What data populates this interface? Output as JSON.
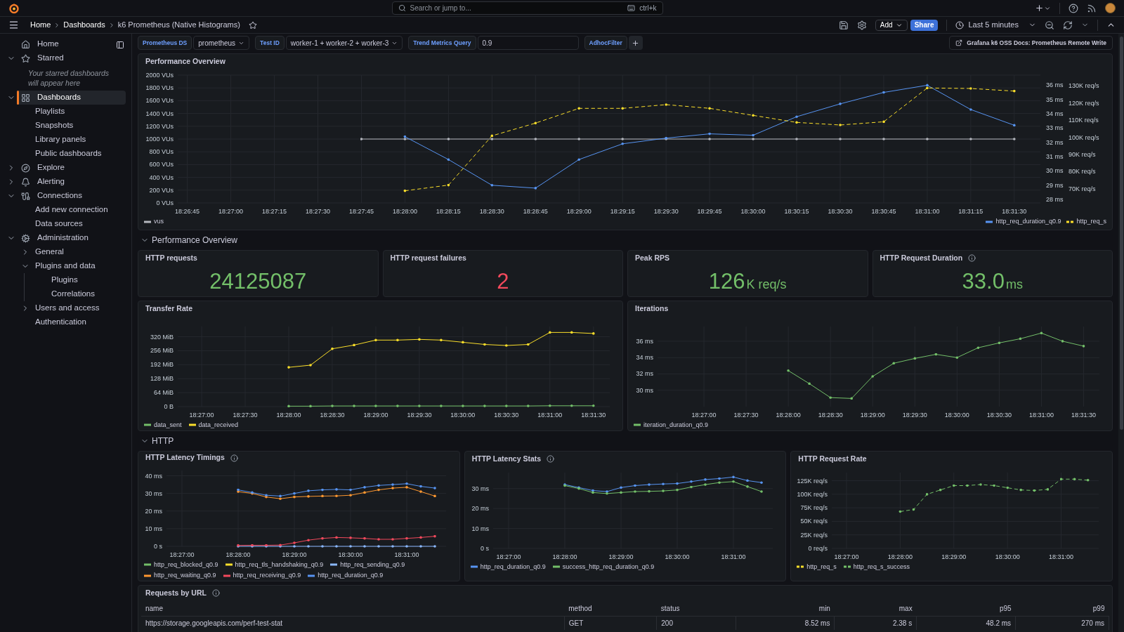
{
  "top_bar": {
    "search": {
      "placeholder": "Search or jump to...",
      "shortcut": "ctrl+k"
    }
  },
  "toolbar": {
    "breadcrumbs": [
      "Home",
      "Dashboards",
      "k6 Prometheus (Native Histograms)"
    ],
    "add_label": "Add",
    "share_label": "Share",
    "time_range": "Last 5 minutes"
  },
  "sidebar": {
    "items": [
      {
        "label": "Home",
        "selected": false
      },
      {
        "label": "Starred",
        "selected": false,
        "expanded": true,
        "note": "Your starred dashboards will appear here"
      },
      {
        "label": "Dashboards",
        "selected": true,
        "expanded": true,
        "children": [
          {
            "label": "Playlists",
            "selected": false
          },
          {
            "label": "Snapshots",
            "selected": false
          },
          {
            "label": "Library panels",
            "selected": false
          },
          {
            "label": "Public dashboards",
            "selected": false
          }
        ]
      },
      {
        "label": "Explore",
        "selected": false,
        "expanded": false
      },
      {
        "label": "Alerting",
        "selected": false,
        "expanded": false
      },
      {
        "label": "Connections",
        "selected": false,
        "expanded": true,
        "children": [
          {
            "label": "Add new connection",
            "selected": false
          },
          {
            "label": "Data sources",
            "selected": false
          }
        ]
      },
      {
        "label": "Administration",
        "selected": false,
        "expanded": true,
        "children": [
          {
            "label": "General",
            "selected": false,
            "expanded": false
          },
          {
            "label": "Plugins and data",
            "selected": false,
            "expanded": true,
            "children": [
              {
                "label": "Plugins",
                "selected": false
              },
              {
                "label": "Correlations",
                "selected": false
              }
            ]
          },
          {
            "label": "Users and access",
            "selected": false,
            "expanded": false
          },
          {
            "label": "Authentication",
            "selected": false
          }
        ]
      }
    ]
  },
  "variables": [
    {
      "kind": "select",
      "label": "Prometheus DS",
      "value": "prometheus"
    },
    {
      "kind": "select",
      "label": "Test ID",
      "value": "worker-1 + worker-2 + worker-3"
    },
    {
      "kind": "text",
      "label": "Trend Metrics Query",
      "value": "0.9"
    },
    {
      "kind": "adhoc",
      "label": "AdhocFilter"
    }
  ],
  "docs_link": "Grafana k6 OSS Docs: Prometheus Remote Write",
  "overview_panel": {
    "title": "Performance Overview",
    "chart_data": {
      "type": "line",
      "categories": [
        "18:26:45",
        "18:27:00",
        "18:27:15",
        "18:27:30",
        "18:27:45",
        "18:28:00",
        "18:28:15",
        "18:28:30",
        "18:28:45",
        "18:29:00",
        "18:29:15",
        "18:29:30",
        "18:29:45",
        "18:30:00",
        "18:30:15",
        "18:30:30",
        "18:30:45",
        "18:31:00",
        "18:31:15",
        "18:31:30"
      ],
      "grid": true,
      "ylim": [
        0,
        2000
      ],
      "y2lim": [
        27.76,
        36.71
      ],
      "y3lim": [
        61700,
        136300
      ],
      "yticks": [
        {
          "value": 0,
          "label": "0 VUs"
        },
        {
          "value": 200,
          "label": "200 VUs"
        },
        {
          "value": 400,
          "label": "400 VUs"
        },
        {
          "value": 600,
          "label": "600 VUs"
        },
        {
          "value": 800,
          "label": "800 VUs"
        },
        {
          "value": 1000,
          "label": "1000 VUs"
        },
        {
          "value": 1200,
          "label": "1200 VUs"
        },
        {
          "value": 1400,
          "label": "1400 VUs"
        },
        {
          "value": 1600,
          "label": "1600 VUs"
        },
        {
          "value": 1800,
          "label": "1800 VUs"
        },
        {
          "value": 2000,
          "label": "2000 VUs"
        }
      ],
      "y2ticks": [
        {
          "value": 28,
          "label": "28 ms"
        },
        {
          "value": 29,
          "label": "29 ms"
        },
        {
          "value": 30,
          "label": "30 ms"
        },
        {
          "value": 31,
          "label": "31 ms"
        },
        {
          "value": 32,
          "label": "32 ms"
        },
        {
          "value": 33,
          "label": "33 ms"
        },
        {
          "value": 34,
          "label": "34 ms"
        },
        {
          "value": 35,
          "label": "35 ms"
        },
        {
          "value": 36,
          "label": "36 ms"
        }
      ],
      "y3ticks": [
        {
          "value": 70000,
          "label": "70K req/s"
        },
        {
          "value": 80000,
          "label": "80K req/s"
        },
        {
          "value": 90000,
          "label": "90K req/s"
        },
        {
          "value": 100000,
          "label": "100K req/s"
        },
        {
          "value": 110000,
          "label": "110K req/s"
        },
        {
          "value": 120000,
          "label": "120K req/s"
        },
        {
          "value": 130000,
          "label": "130K req/s"
        }
      ],
      "series": [
        {
          "name": "vus",
          "color": "#b5b8bf",
          "axis": "y",
          "values": [
            null,
            null,
            null,
            null,
            1000,
            1000,
            1000,
            1000,
            1000,
            1000,
            1000,
            1000,
            1000,
            1000,
            1000,
            1000,
            1000,
            1000,
            1000,
            1000
          ]
        },
        {
          "name": "http_req_duration_q0.9",
          "color": "#5794f2",
          "axis": "y2",
          "values": [
            null,
            null,
            null,
            null,
            null,
            32.4,
            30.8,
            29.0,
            28.8,
            30.8,
            31.9,
            32.3,
            32.6,
            32.5,
            33.8,
            34.7,
            35.5,
            36.0,
            34.3,
            33.2
          ]
        },
        {
          "name": "http_req_s",
          "color": "#fade2a",
          "axis": "y3",
          "line_style": "dashed",
          "values": [
            null,
            null,
            null,
            null,
            null,
            68800,
            72100,
            100900,
            108300,
            116900,
            116900,
            119100,
            116900,
            112800,
            108700,
            107200,
            109100,
            128800,
            128500,
            127000
          ]
        }
      ]
    }
  },
  "rows": [
    {
      "title": "Performance Overview",
      "expanded": true
    },
    {
      "title": "HTTP",
      "expanded": true
    }
  ],
  "stats": [
    {
      "title": "HTTP requests",
      "value": "24125087",
      "color": "#73bf69",
      "info_icon": false
    },
    {
      "title": "HTTP request failures",
      "value": "2",
      "color": "#f2495c",
      "info_icon": false
    },
    {
      "title": "Peak RPS",
      "value": "126",
      "unit": "K req/s",
      "color": "#73bf69",
      "info_icon": false
    },
    {
      "title": "HTTP Request Duration",
      "value": "33.0",
      "unit": "ms",
      "color": "#73bf69",
      "info_icon": true
    }
  ],
  "middle_panels": [
    {
      "title": "Transfer Rate",
      "info_icon": false,
      "chart_data": {
        "type": "line",
        "categories": [
          "18:27:00",
          null,
          "18:27:30",
          null,
          "18:28:00",
          null,
          "18:28:30",
          null,
          "18:29:00",
          null,
          "18:29:30",
          null,
          "18:30:00",
          null,
          "18:30:30",
          null,
          "18:31:00",
          null,
          "18:31:30"
        ],
        "grid": true,
        "ylim": [
          0,
          367
        ],
        "yticks": [
          {
            "value": 0,
            "label": "0 B"
          },
          {
            "value": 64,
            "label": "64 MiB"
          },
          {
            "value": 128,
            "label": "128 MiB"
          },
          {
            "value": 192,
            "label": "192 MiB"
          },
          {
            "value": 256,
            "label": "256 MiB"
          },
          {
            "value": 320,
            "label": "320 MiB"
          }
        ],
        "series": [
          {
            "name": "data_sent",
            "color": "#73bf69",
            "values": [
              null,
              null,
              null,
              null,
              2,
              2,
              3,
              3,
              3,
              3,
              3,
              3,
              3,
              3,
              3,
              3,
              4,
              4,
              4
            ]
          },
          {
            "name": "data_received",
            "color": "#fade2a",
            "values": [
              null,
              null,
              null,
              null,
              180,
              190,
              265,
              282,
              305,
              305,
              308,
              305,
              295,
              285,
              280,
              285,
              340,
              340,
              335
            ]
          }
        ]
      }
    },
    {
      "title": "Iterations",
      "info_icon": false,
      "chart_data": {
        "type": "line",
        "categories": [
          "18:27:00",
          null,
          "18:27:30",
          null,
          "18:28:00",
          null,
          "18:28:30",
          null,
          "18:29:00",
          null,
          "18:29:30",
          null,
          "18:30:00",
          null,
          "18:30:30",
          null,
          "18:31:00",
          null,
          "18:31:30"
        ],
        "grid": true,
        "ylim": [
          28,
          37.8
        ],
        "yticks": [
          {
            "value": 30,
            "label": "30 ms"
          },
          {
            "value": 32,
            "label": "32 ms"
          },
          {
            "value": 34,
            "label": "34 ms"
          },
          {
            "value": 36,
            "label": "36 ms"
          }
        ],
        "series": [
          {
            "name": "iteration_duration_q0.9",
            "color": "#73bf69",
            "values": [
              null,
              null,
              null,
              null,
              32.4,
              30.8,
              29.1,
              29.0,
              31.7,
              33.3,
              33.9,
              34.4,
              34.0,
              35.2,
              35.8,
              36.3,
              37.0,
              36.0,
              35.4
            ]
          }
        ]
      }
    }
  ],
  "bottom_panels": [
    {
      "title": "HTTP Latency Timings",
      "info_icon": true,
      "chart_data": {
        "type": "line",
        "categories": [
          "18:27:00",
          null,
          null,
          null,
          "18:28:00",
          null,
          null,
          null,
          "18:29:00",
          null,
          null,
          null,
          "18:30:00",
          null,
          null,
          null,
          "18:31:00",
          null,
          null
        ],
        "grid": true,
        "ylim": [
          0,
          43
        ],
        "yticks": [
          {
            "value": 0,
            "label": "0 s"
          },
          {
            "value": 10,
            "label": "10 ms"
          },
          {
            "value": 20,
            "label": "20 ms"
          },
          {
            "value": 30,
            "label": "30 ms"
          },
          {
            "value": 40,
            "label": "40 ms"
          }
        ],
        "series": [
          {
            "name": "http_req_blocked_q0.9",
            "color": "#73bf69",
            "values": [
              null,
              null,
              null,
              null,
              null,
              null,
              null,
              null,
              null,
              null,
              null,
              null,
              null,
              null,
              null,
              null,
              null,
              null,
              null
            ]
          },
          {
            "name": "http_req_tls_handshaking_q0.9",
            "color": "#fade2a",
            "values": [
              null,
              null,
              null,
              null,
              null,
              null,
              null,
              null,
              null,
              null,
              null,
              null,
              null,
              null,
              null,
              null,
              null,
              null,
              null
            ]
          },
          {
            "name": "http_req_sending_q0.9",
            "color": "#8ab8ff",
            "values": [
              null,
              null,
              null,
              null,
              0,
              0,
              0,
              0,
              0,
              0,
              0,
              0,
              0,
              0,
              0,
              0,
              0,
              0,
              0
            ]
          },
          {
            "name": "http_req_waiting_q0.9",
            "color": "#ff9830",
            "values": [
              null,
              null,
              null,
              null,
              31,
              30,
              28,
              27,
              28,
              28.3,
              28.5,
              28.6,
              29,
              30.5,
              32,
              33,
              33.5,
              31,
              28.5
            ]
          },
          {
            "name": "http_req_receiving_q0.9",
            "color": "#f2495c",
            "values": [
              null,
              null,
              null,
              null,
              0.5,
              0.6,
              0.6,
              0.7,
              2,
              3.5,
              4.5,
              5,
              4.8,
              4.5,
              4,
              4,
              4.5,
              5,
              5.7
            ]
          },
          {
            "name": "http_req_duration_q0.9",
            "color": "#5794f2",
            "values": [
              null,
              null,
              null,
              null,
              32,
              30.5,
              29,
              28.5,
              30,
              31.5,
              32,
              32.3,
              32,
              33.5,
              34.5,
              35,
              35.5,
              34,
              33
            ]
          }
        ]
      }
    },
    {
      "title": "HTTP Latency Stats",
      "info_icon": true,
      "chart_data": {
        "type": "line",
        "categories": [
          "18:27:00",
          null,
          null,
          null,
          "18:28:00",
          null,
          null,
          null,
          "18:29:00",
          null,
          null,
          null,
          "18:30:00",
          null,
          null,
          null,
          "18:31:00",
          null,
          null
        ],
        "grid": true,
        "ylim": [
          0,
          38
        ],
        "yticks": [
          {
            "value": 0,
            "label": "0 s"
          },
          {
            "value": 10,
            "label": "10 ms"
          },
          {
            "value": 20,
            "label": "20 ms"
          },
          {
            "value": 30,
            "label": "30 ms"
          }
        ],
        "series": [
          {
            "name": "http_req_duration_q0.9",
            "color": "#5794f2",
            "values": [
              null,
              null,
              null,
              null,
              32,
              30.5,
              29,
              28.5,
              30.5,
              31.5,
              32,
              32.3,
              32.5,
              33.5,
              34.5,
              35,
              35.8,
              34,
              33
            ]
          },
          {
            "name": "success_http_req_duration_q0.9",
            "color": "#73bf69",
            "values": [
              null,
              null,
              null,
              null,
              31.5,
              30,
              28,
              27.5,
              28,
              28.5,
              28.6,
              28.8,
              29.3,
              30.8,
              32,
              33,
              33.5,
              31,
              28.5
            ]
          }
        ]
      }
    },
    {
      "title": "HTTP Request Rate",
      "info_icon": false,
      "chart_data": {
        "type": "line",
        "categories": [
          "18:27:00",
          null,
          null,
          null,
          "18:28:00",
          null,
          null,
          null,
          "18:29:00",
          null,
          null,
          null,
          "18:30:00",
          null,
          null,
          null,
          "18:31:00",
          null,
          null
        ],
        "grid": true,
        "ylim": [
          0,
          140000
        ],
        "yticks": [
          {
            "value": 0,
            "label": "0 req/s"
          },
          {
            "value": 25000,
            "label": "25K req/s"
          },
          {
            "value": 50000,
            "label": "50K req/s"
          },
          {
            "value": 75000,
            "label": "75K req/s"
          },
          {
            "value": 100000,
            "label": "100K req/s"
          },
          {
            "value": 125000,
            "label": "125K req/s"
          }
        ],
        "series": [
          {
            "name": "http_req_s",
            "color": "#fade2a",
            "line_style": "dashed",
            "values": [
              null,
              null,
              null,
              null,
              null,
              null,
              null,
              null,
              null,
              null,
              null,
              null,
              null,
              null,
              null,
              null,
              null,
              null,
              null
            ]
          },
          {
            "name": "http_req_s_success",
            "color": "#73bf69",
            "line_style": "dashed",
            "values": [
              null,
              null,
              null,
              null,
              68000,
              72000,
              100000,
              108000,
              116000,
              116000,
              118000,
              116000,
              112000,
              108000,
              107000,
              109000,
              128000,
              128000,
              126000
            ]
          }
        ]
      }
    }
  ],
  "table": {
    "title": "Requests by URL",
    "info_icon": true,
    "columns": [
      "name",
      "method",
      "status",
      "min",
      "max",
      "p95",
      "p99"
    ],
    "rows": [
      [
        "https://storage.googleapis.com/perf-test-stat",
        "GET",
        "200",
        "8.52 ms",
        "2.38 s",
        "48.2 ms",
        "270 ms"
      ]
    ]
  }
}
